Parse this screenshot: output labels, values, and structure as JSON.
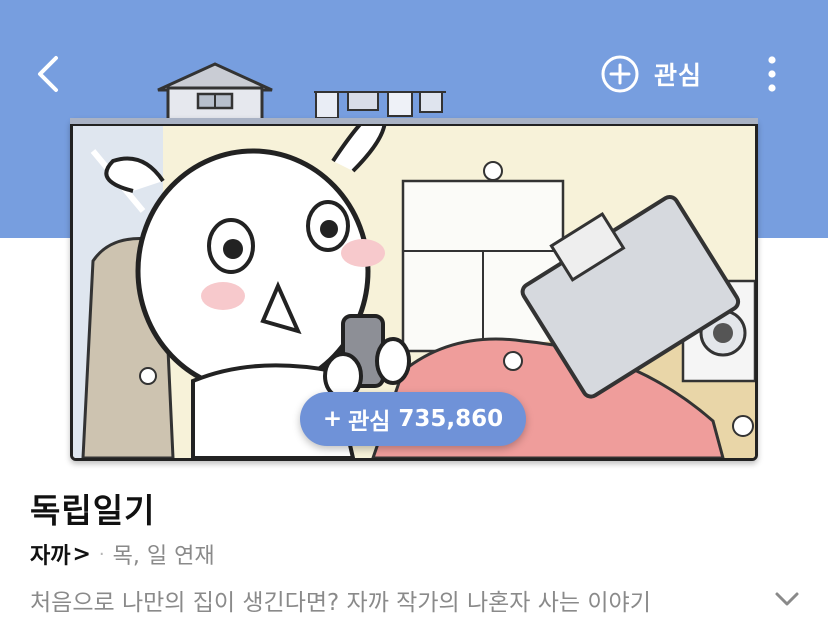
{
  "header": {
    "favorite_label": "관심",
    "accent_color": "#779edf"
  },
  "cover": {
    "favorite_button_plus": "+",
    "favorite_button_label": "관심",
    "favorite_count": "735,860"
  },
  "info": {
    "title": "독립일기",
    "author": "자까",
    "author_chevron": ">",
    "separator": "·",
    "schedule": "목, 일 연재",
    "description": "처음으로 나만의 집이 생긴다면? 자까 작가의 나혼자 사는 이야기"
  },
  "icons": {
    "back": "back-chevron-icon",
    "favorite": "plus-circle-icon",
    "more": "more-vertical-icon",
    "expand": "chevron-down-icon"
  }
}
